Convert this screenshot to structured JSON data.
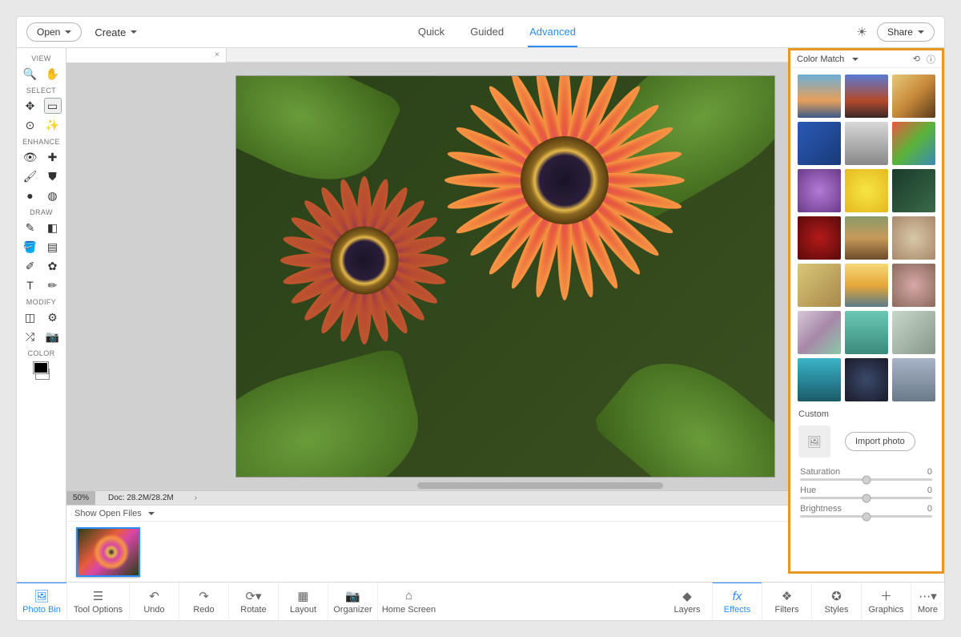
{
  "topbar": {
    "open": "Open",
    "create": "Create",
    "tabs": [
      "Quick",
      "Guided",
      "Advanced"
    ],
    "active_tab": "Advanced",
    "share": "Share"
  },
  "left": {
    "sections": [
      "VIEW",
      "SELECT",
      "ENHANCE",
      "DRAW",
      "MODIFY",
      "COLOR"
    ]
  },
  "canvas": {
    "tab_close": "×",
    "zoom": "50%",
    "doc": "Doc: 28.2M/28.2M"
  },
  "openfiles": {
    "label": "Show Open Files"
  },
  "bottombar": {
    "left": [
      "Photo Bin",
      "Tool Options",
      "Undo",
      "Redo",
      "Rotate",
      "Layout",
      "Organizer",
      "Home Screen"
    ],
    "right": [
      "Layers",
      "Effects",
      "Filters",
      "Styles",
      "Graphics",
      "More"
    ],
    "active_left": "Photo Bin",
    "active_right": "Effects"
  },
  "rpanel": {
    "title": "Color Match",
    "custom": "Custom",
    "import": "Import photo",
    "sliders": [
      {
        "label": "Saturation",
        "value": "0"
      },
      {
        "label": "Hue",
        "value": "0"
      },
      {
        "label": "Brightness",
        "value": "0"
      }
    ]
  }
}
